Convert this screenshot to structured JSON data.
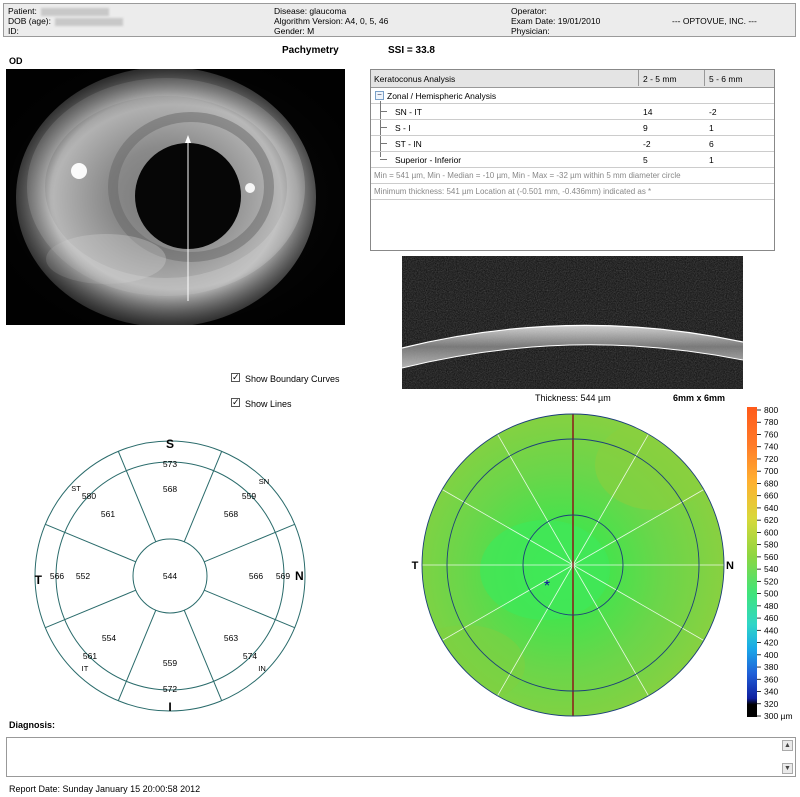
{
  "header": {
    "patient_label": "Patient:",
    "dob_label": "DOB (age):",
    "id_label": "ID:",
    "disease": "Disease: glaucoma",
    "algorithm": "Algorithm Version: A4, 0, 5, 46",
    "gender": "Gender: M",
    "operator": "Operator:",
    "exam_date": "Exam Date: 19/01/2010",
    "physician": "Physician:",
    "company": "--- OPTOVUE, INC. ---"
  },
  "title": "Pachymetry",
  "ssi": "SSI = 33.8",
  "eye": "OD",
  "keratoconus": {
    "title": "Keratoconus Analysis",
    "col1": "2 - 5 mm",
    "col2": "5 - 6 mm",
    "group": "Zonal / Hemispheric Analysis",
    "rows": [
      {
        "label": "SN - IT",
        "v1": "14",
        "v2": "-2"
      },
      {
        "label": "S - I",
        "v1": "9",
        "v2": "1"
      },
      {
        "label": "ST - IN",
        "v1": "-2",
        "v2": "6"
      },
      {
        "label": "Superior - Inferior",
        "v1": "5",
        "v2": "1"
      }
    ],
    "note1": "Min = 541 µm, Min - Median = -10 µm, Min - Max = -32 µm within 5 mm diameter circle",
    "note2": "Minimum thickness: 541 µm     Location at (-0.501 mm, -0.436mm) indicated as *"
  },
  "controls": {
    "show_boundary": "Show Boundary Curves",
    "show_lines": "Show Lines"
  },
  "thickness": "Thickness: 544 µm",
  "scan_size": "6mm x 6mm",
  "sector_map": {
    "labels": {
      "s": "S",
      "i": "I",
      "t": "T",
      "n": "N",
      "st": "ST",
      "sn": "SN",
      "it": "IT",
      "in": "IN"
    },
    "center": "544",
    "inner": {
      "s": "568",
      "sn": "568",
      "n": "566",
      "in": "563",
      "i": "559",
      "it": "554",
      "t": "552",
      "st": "561"
    },
    "outer": {
      "s": "573",
      "sn": "559",
      "n": "569",
      "in": "574",
      "i": "572",
      "it": "561",
      "t": "566",
      "st": "580"
    }
  },
  "color_map": {
    "t": "T",
    "n": "N",
    "min_marker": "*",
    "scale": [
      "800",
      "780",
      "760",
      "740",
      "720",
      "700",
      "680",
      "660",
      "640",
      "620",
      "600",
      "580",
      "560",
      "540",
      "520",
      "500",
      "480",
      "460",
      "440",
      "420",
      "400",
      "380",
      "360",
      "340",
      "320",
      "300 µm"
    ]
  },
  "diagnosis_label": "Diagnosis:",
  "report_date": "Report Date: Sunday January 15 20:00:58 2012"
}
